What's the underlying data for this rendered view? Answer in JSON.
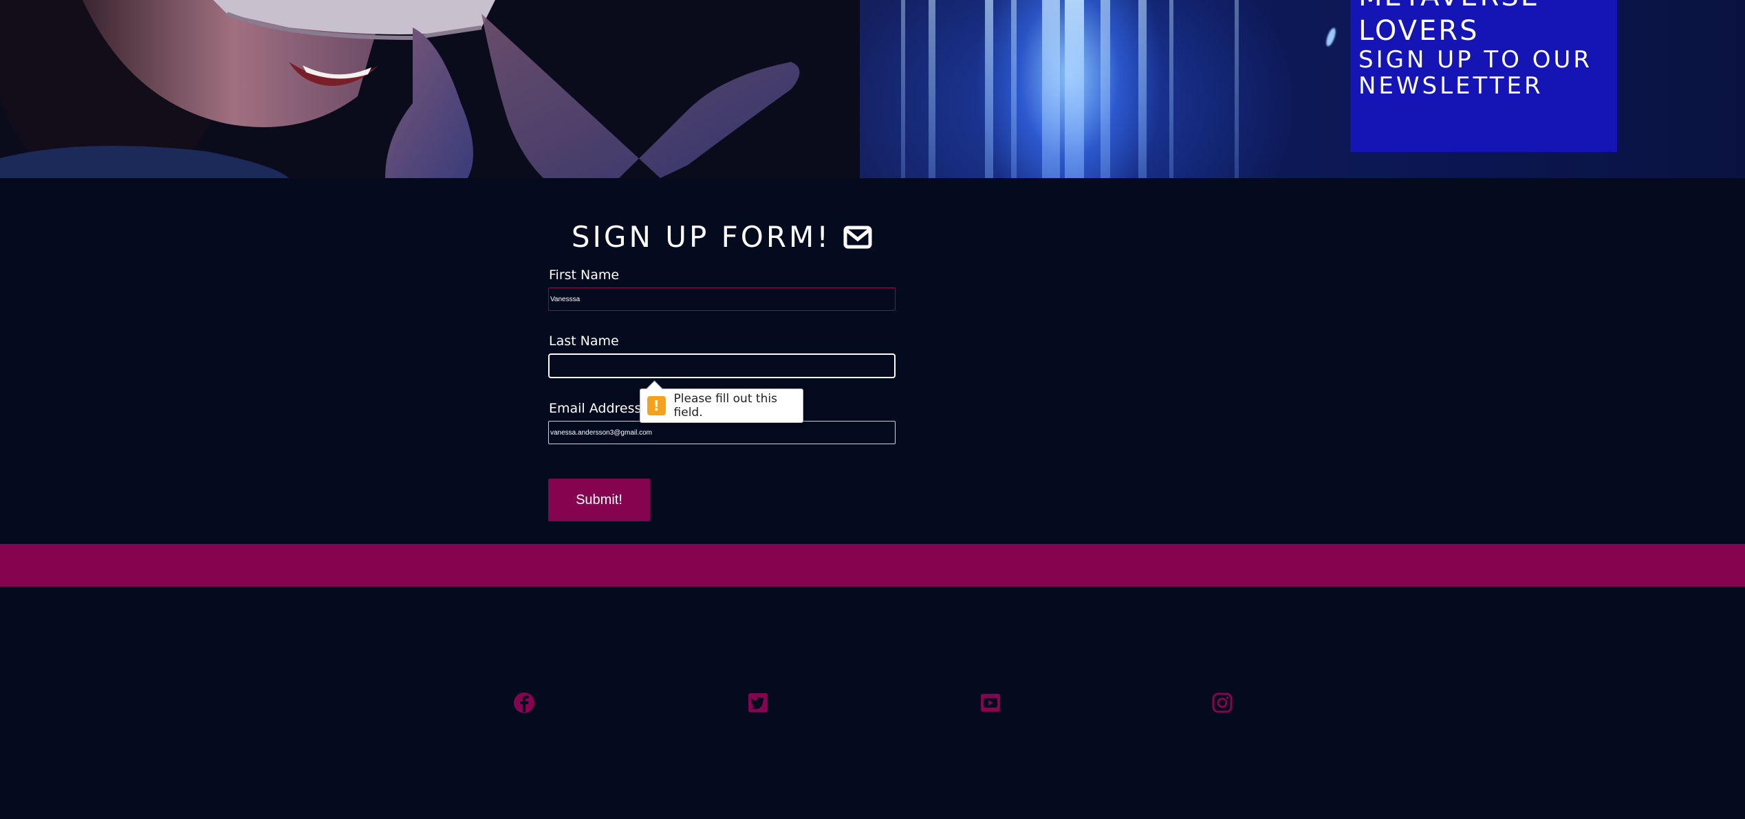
{
  "hero": {
    "title_lines": [
      "METAVERSE",
      "LOVERS"
    ],
    "subtitle_lines": [
      "SIGN UP TO OUR",
      "NEWSLETTER"
    ]
  },
  "form": {
    "title": "SIGN UP FORM!",
    "title_icon": "envelope-icon",
    "first_name": {
      "label": "First Name",
      "value": "Vanesssa"
    },
    "last_name": {
      "label": "Last Name",
      "value": ""
    },
    "email": {
      "label": "Email Address",
      "value": "vanessa.andersson3@gmail.com"
    },
    "submit_label": "Submit!"
  },
  "validation_tooltip": {
    "icon": "warning-icon",
    "text": "Please fill out this field."
  },
  "footer": {
    "social_icons": [
      "facebook-icon",
      "twitter-icon",
      "youtube-icon",
      "instagram-icon"
    ],
    "icon_color": "#85034f"
  },
  "colors": {
    "background": "#040b1f",
    "accent": "#85034f",
    "hero_box": "#1515b5"
  }
}
